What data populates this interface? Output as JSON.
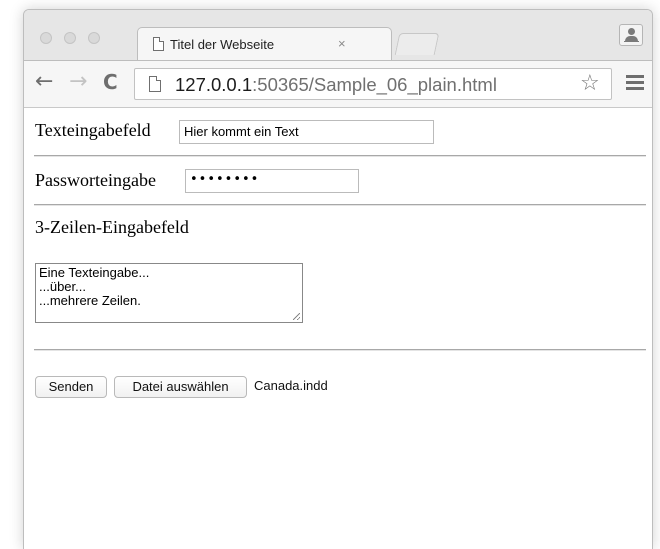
{
  "browser": {
    "tab": {
      "title": "Titel der Webseite",
      "close": "×"
    },
    "toolbar": {
      "back": "←",
      "forward": "→",
      "reload": "C",
      "url_host": "127.0.0.1",
      "url_rest": ":50365/Sample_06_plain.html",
      "star": "☆"
    },
    "icons": [
      "page-icon",
      "star-icon",
      "hamburger-menu-icon",
      "profile-icon",
      "close-icon"
    ],
    "colors": {
      "tabstrip": "#e6e6e6",
      "toolbar": "#f6f6f6",
      "url_host": "#1c1c1c",
      "url_rest": "#707070"
    }
  },
  "page": {
    "text_field": {
      "label": "Texteingabefeld",
      "value": "Hier kommt ein Text"
    },
    "password_field": {
      "label": "Passworteingabe",
      "masked_value": "••••••••"
    },
    "textarea_field": {
      "label": "3-Zeilen-Eingabefeld",
      "lines": [
        "Eine Texteingabe...",
        "...über...",
        "...mehrere Zeilen."
      ]
    },
    "submit_label": "Senden",
    "file_button_label": "Datei auswählen",
    "file_name": "Canada.indd"
  }
}
